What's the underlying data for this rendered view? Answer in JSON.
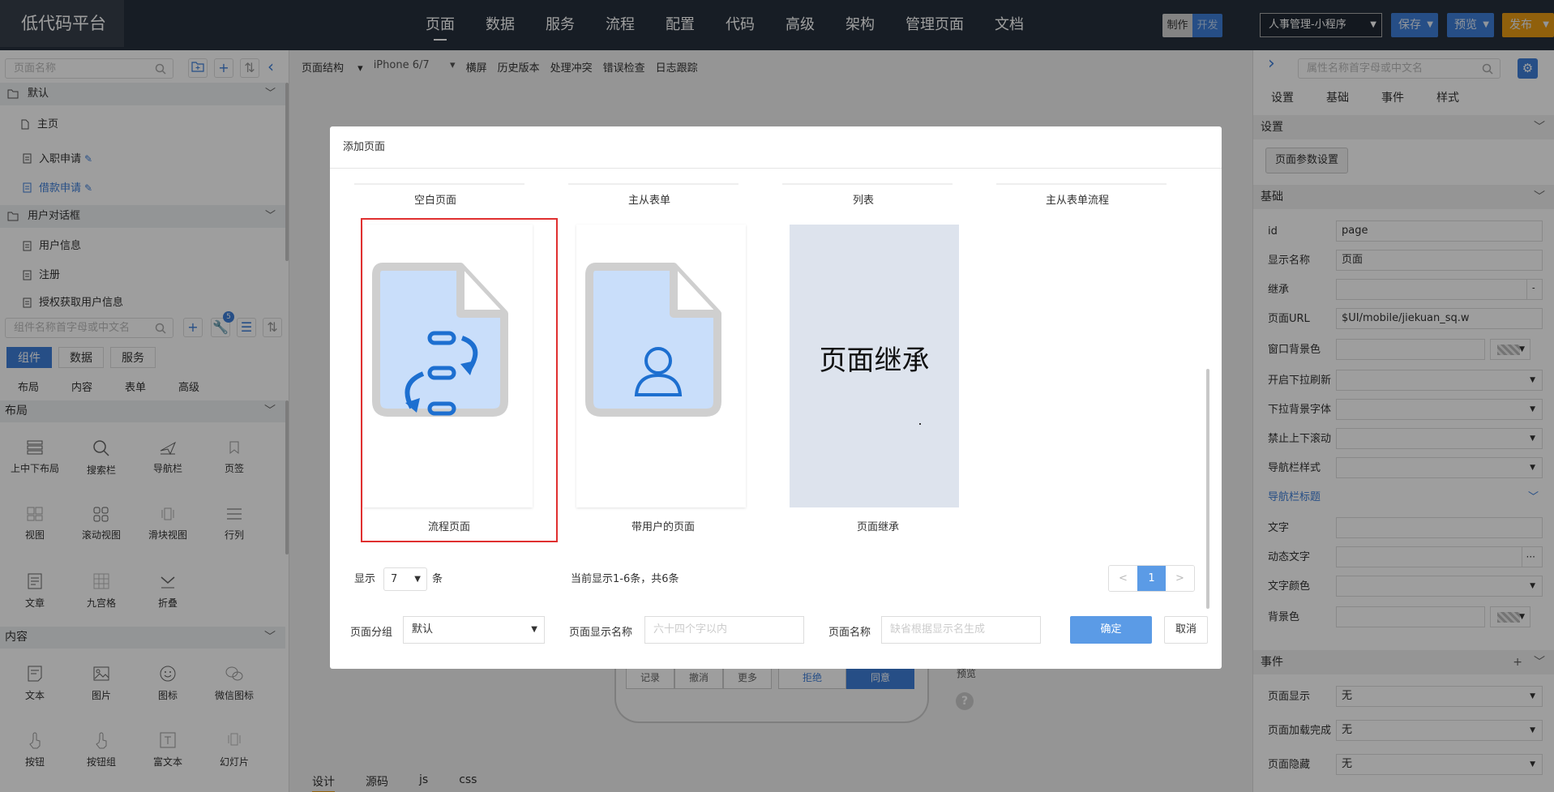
{
  "app": {
    "brand": "低代码平台"
  },
  "topnav": [
    "页面",
    "数据",
    "服务",
    "流程",
    "配置",
    "代码",
    "高级",
    "架构",
    "管理页面",
    "文档"
  ],
  "mode": {
    "design": "制作",
    "dev": "开发"
  },
  "app_selector": "人事管理-小程序",
  "actions": {
    "save": "保存",
    "preview": "预览",
    "publish": "发布"
  },
  "left": {
    "page_search_placeholder": "页面名称",
    "sections": [
      {
        "name": "默认",
        "items": [
          "主页",
          "入职申请",
          "借款申请"
        ]
      },
      {
        "name": "用户对话框",
        "items": [
          "用户信息",
          "注册",
          "授权获取用户信息"
        ]
      }
    ],
    "component_search_placeholder": "组件名称首字母或中文名",
    "badge": "5",
    "tabs": [
      "组件",
      "数据",
      "服务"
    ],
    "subtabs": [
      "布局",
      "内容",
      "表单",
      "高级"
    ],
    "groups": {
      "layout": "布局",
      "content": "内容"
    },
    "layout_components": [
      "上中下布局",
      "搜索栏",
      "导航栏",
      "页签",
      "视图",
      "滚动视图",
      "滑块视图",
      "行列",
      "文章",
      "九宫格",
      "折叠"
    ],
    "content_components": [
      "文本",
      "图片",
      "图标",
      "微信图标",
      "按钮",
      "按钮组",
      "富文本",
      "幻灯片"
    ]
  },
  "editor": {
    "toolbar": [
      "页面结构",
      "iPhone 6/7",
      "横屏",
      "历史版本",
      "处理冲突",
      "错误检查",
      "日志跟踪"
    ],
    "phone_buttons": [
      "记录",
      "撤消",
      "更多",
      "拒绝",
      "同意"
    ],
    "preview_label": "预览",
    "help": "?",
    "bottom_tabs": [
      "设计",
      "源码",
      "js",
      "css"
    ]
  },
  "right": {
    "search_placeholder": "属性名称首字母或中文名",
    "tabs": [
      "设置",
      "基础",
      "事件",
      "样式"
    ],
    "sec_settings": "设置",
    "page_param_button": "页面参数设置",
    "sec_basic": "基础",
    "props": [
      {
        "label": "id",
        "value": "page"
      },
      {
        "label": "显示名称",
        "value": "页面"
      },
      {
        "label": "继承",
        "value": ""
      },
      {
        "label": "页面URL",
        "value": "$UI/mobile/jiekuan_sq.w"
      },
      {
        "label": "窗口背景色",
        "value": ""
      },
      {
        "label": "开启下拉刷新",
        "value": ""
      },
      {
        "label": "下拉背景字体",
        "value": ""
      },
      {
        "label": "禁止上下滚动",
        "value": ""
      },
      {
        "label": "导航栏样式",
        "value": ""
      }
    ],
    "sub_nav_title": "导航栏标题",
    "nav_props": [
      {
        "label": "文字",
        "value": ""
      },
      {
        "label": "动态文字",
        "value": ""
      },
      {
        "label": "文字颜色",
        "value": ""
      },
      {
        "label": "背景色",
        "value": ""
      }
    ],
    "sec_events": "事件",
    "events": [
      {
        "label": "页面显示",
        "value": "无"
      },
      {
        "label": "页面加载完成",
        "value": "无"
      },
      {
        "label": "页面隐藏",
        "value": "无"
      }
    ]
  },
  "modal": {
    "title": "添加页面",
    "top_templates": [
      "空白页面",
      "主从表单",
      "列表",
      "主从表单流程"
    ],
    "cards": [
      "流程页面",
      "带用户的页面",
      "页面继承"
    ],
    "inherit_text": "页面继承",
    "show_label": "显示",
    "page_size": "7",
    "unit": "条",
    "status": "当前显示1-6条，共6条",
    "pager": {
      "prev": "<",
      "current": "1",
      "next": ">"
    },
    "group_label": "页面分组",
    "group_value": "默认",
    "display_name_label": "页面显示名称",
    "display_name_placeholder": "六十四个字以内",
    "page_name_label": "页面名称",
    "page_name_placeholder": "缺省根据显示名生成",
    "ok": "确定",
    "cancel": "取消"
  },
  "colors": {
    "accent": "#3e7fd9",
    "publish": "#e89c14",
    "selection": "#e03030"
  }
}
